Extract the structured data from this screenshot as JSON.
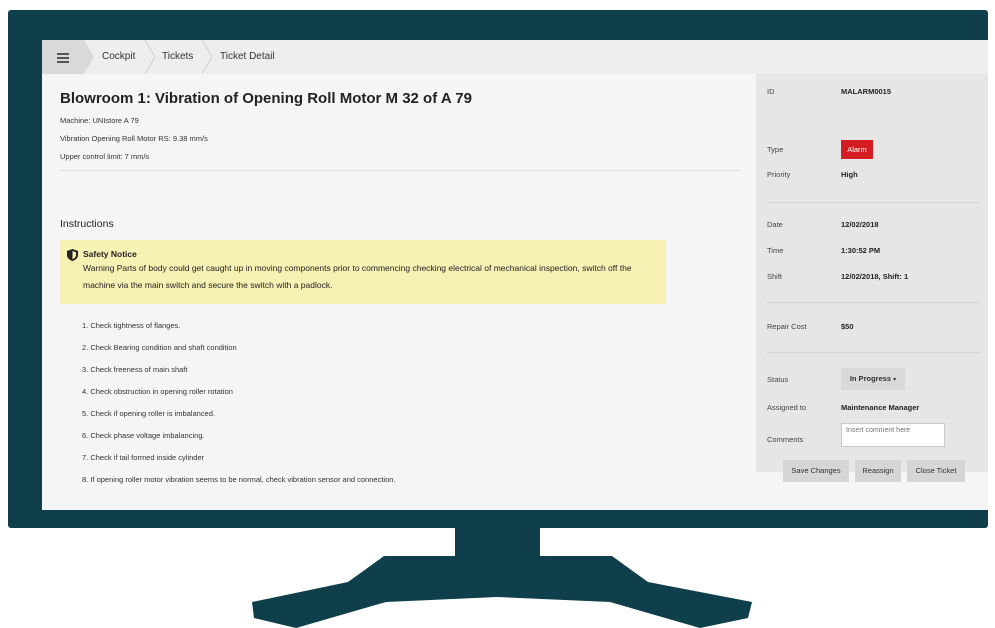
{
  "colors": {
    "monitor": "#0e3f4a",
    "alarm_badge": "#d41d22",
    "notice_bg": "#f7f1b4"
  },
  "breadcrumb": {
    "menu_icon": "hamburger-icon",
    "items": [
      "Cockpit",
      "Tickets",
      "Ticket Detail"
    ]
  },
  "ticket": {
    "title": "Blowroom 1: Vibration of Opening Roll Motor M 32 of A 79",
    "machine": "Machine: UNIstore A 79",
    "vibration": "Vibration Opening Roll Motor RS: 9.38 mm/s",
    "upper_limit": "Upper control limit: 7 mm/s"
  },
  "instructions": {
    "heading": "Instructions",
    "notice_icon": "shield-icon",
    "notice_title": "Safety Notice",
    "notice_text": "Warning Parts of body could get caught up in moving components prior to commencing checking electrical of mechanical inspection, switch off the machine via the main switch and secure the switch with a padlock.",
    "steps": [
      "1. Check tightness of flanges.",
      "2. Check Bearing condition and shaft condition",
      "3. Check freeness of main shaft",
      "4. Check obstruction in opening roller rotation",
      "5. Check if opening roller is imbalanced.",
      "6. Check phase voltage imbalancing.",
      "7. Check if tail formed inside cylinder",
      "8. If opening roller motor vibration seems to be normal, check vibration sensor and connection."
    ]
  },
  "details": {
    "id_label": "ID",
    "id_value": "MALARM0015",
    "type_label": "Type",
    "type_value": "Alarm",
    "priority_label": "Priority",
    "priority_value": "High",
    "date_label": "Date",
    "date_value": "12/02/2018",
    "time_label": "Time",
    "time_value": "1:30:52 PM",
    "shift_label": "Shift",
    "shift_value": "12/02/2018, Shift: 1",
    "cost_label": "Repair Cost",
    "cost_value": "$50",
    "status_label": "Status",
    "status_value": "In Progress",
    "assigned_label": "Assigned to",
    "assigned_value": "Maintenance Manager",
    "comments_label": "Comments",
    "comments_placeholder": "Insert comment here"
  },
  "actions": {
    "save": "Save Changes",
    "reassign": "Reassign",
    "close": "Close Ticket"
  }
}
